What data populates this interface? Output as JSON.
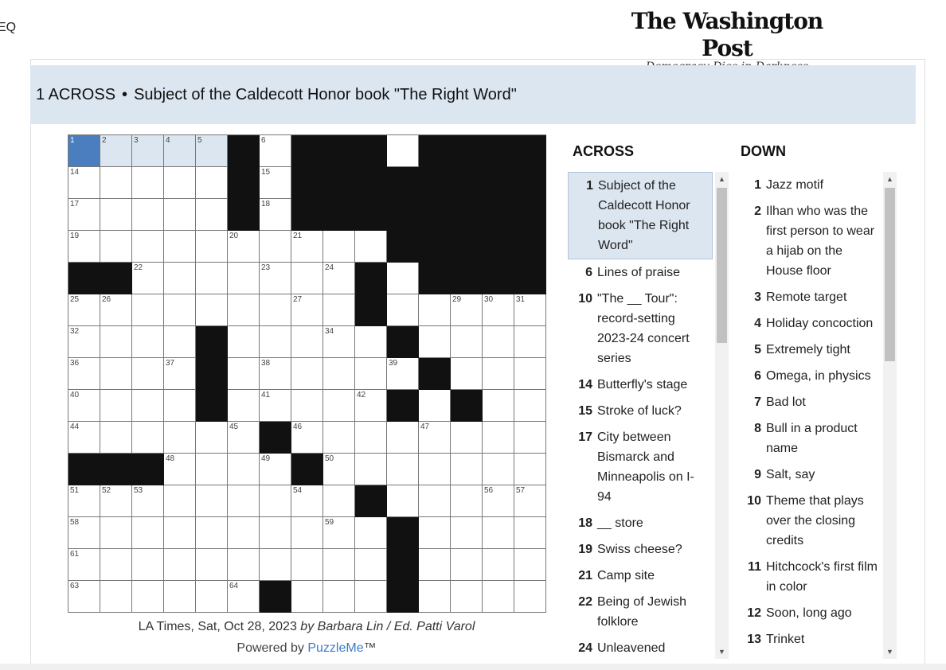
{
  "header": {
    "menu_fragment": "EQ",
    "logo_name": "The Washington Post",
    "logo_tagline": "Democracy Dies in Darkness"
  },
  "banner": {
    "clue_ref": "1 ACROSS",
    "separator": "•",
    "clue_text": "Subject of the Caldecott Honor book \"The Right Word\""
  },
  "grid": {
    "size": 15,
    "rows": [
      "#####.#...#....",
      "#####.#........",
      "#####.#........",
      "##########.....",
      "..#######.#....",
      "#########.#####",
      "####.#####.####",
      "####.######.###",
      "####.#####.#.##",
      "######.########",
      "...####.#######",
      "#########.#####",
      "##########.####",
      "##########.####",
      "######.###.####"
    ],
    "numbers": [
      [
        0,
        0,
        1
      ],
      [
        0,
        1,
        2
      ],
      [
        0,
        2,
        3
      ],
      [
        0,
        3,
        4
      ],
      [
        0,
        4,
        5
      ],
      [
        0,
        6,
        6
      ],
      [
        0,
        7,
        7
      ],
      [
        0,
        8,
        8
      ],
      [
        0,
        9,
        9
      ],
      [
        0,
        11,
        10
      ],
      [
        0,
        12,
        11
      ],
      [
        0,
        13,
        12
      ],
      [
        0,
        14,
        13
      ],
      [
        1,
        0,
        14
      ],
      [
        1,
        6,
        15
      ],
      [
        1,
        10,
        16
      ],
      [
        2,
        0,
        17
      ],
      [
        2,
        6,
        18
      ],
      [
        3,
        0,
        19
      ],
      [
        3,
        5,
        20
      ],
      [
        3,
        7,
        21
      ],
      [
        4,
        2,
        22
      ],
      [
        4,
        6,
        23
      ],
      [
        4,
        8,
        24
      ],
      [
        5,
        0,
        25
      ],
      [
        5,
        1,
        26
      ],
      [
        5,
        7,
        27
      ],
      [
        5,
        9,
        28
      ],
      [
        5,
        12,
        29
      ],
      [
        5,
        13,
        30
      ],
      [
        5,
        14,
        31
      ],
      [
        6,
        0,
        32
      ],
      [
        6,
        4,
        33
      ],
      [
        6,
        8,
        34
      ],
      [
        6,
        10,
        35
      ],
      [
        7,
        0,
        36
      ],
      [
        7,
        3,
        37
      ],
      [
        7,
        6,
        38
      ],
      [
        7,
        10,
        39
      ],
      [
        8,
        0,
        40
      ],
      [
        8,
        6,
        41
      ],
      [
        8,
        9,
        42
      ],
      [
        8,
        12,
        43
      ],
      [
        9,
        0,
        44
      ],
      [
        9,
        5,
        45
      ],
      [
        9,
        7,
        46
      ],
      [
        9,
        11,
        47
      ],
      [
        10,
        3,
        48
      ],
      [
        10,
        6,
        49
      ],
      [
        10,
        8,
        50
      ],
      [
        11,
        0,
        51
      ],
      [
        11,
        1,
        52
      ],
      [
        11,
        2,
        53
      ],
      [
        11,
        7,
        54
      ],
      [
        11,
        9,
        55
      ],
      [
        11,
        13,
        56
      ],
      [
        11,
        14,
        57
      ],
      [
        12,
        0,
        58
      ],
      [
        12,
        8,
        59
      ],
      [
        12,
        10,
        60
      ],
      [
        13,
        0,
        61
      ],
      [
        13,
        10,
        62
      ],
      [
        14,
        0,
        63
      ],
      [
        14,
        5,
        64
      ],
      [
        14,
        10,
        65
      ]
    ]
  },
  "credit": {
    "pub": "LA Times, Sat, Oct 28, 2023",
    "by": "by Barbara Lin / Ed. Patti Varol"
  },
  "powered": {
    "prefix": "Powered by",
    "link": "PuzzleMe",
    "suffix": "™"
  },
  "across": {
    "heading": "ACROSS",
    "clues": [
      {
        "n": "1",
        "t": "Subject of the Caldecott Honor book \"The Right Word\""
      },
      {
        "n": "6",
        "t": "Lines of praise"
      },
      {
        "n": "10",
        "t": "\"The __ Tour\": record-setting 2023-24 concert series"
      },
      {
        "n": "14",
        "t": "Butterfly's stage"
      },
      {
        "n": "15",
        "t": "Stroke of luck?"
      },
      {
        "n": "17",
        "t": "City between Bismarck and Minneapolis on I-94"
      },
      {
        "n": "18",
        "t": "__ store"
      },
      {
        "n": "19",
        "t": "Swiss cheese?"
      },
      {
        "n": "21",
        "t": "Camp site"
      },
      {
        "n": "22",
        "t": "Being of Jewish folklore"
      },
      {
        "n": "24",
        "t": "Unleavened"
      }
    ]
  },
  "down": {
    "heading": "DOWN",
    "clues": [
      {
        "n": "1",
        "t": "Jazz motif"
      },
      {
        "n": "2",
        "t": "Ilhan who was the first person to wear a hijab on the House floor"
      },
      {
        "n": "3",
        "t": "Remote target"
      },
      {
        "n": "4",
        "t": "Holiday concoction"
      },
      {
        "n": "5",
        "t": "Extremely tight"
      },
      {
        "n": "6",
        "t": "Omega, in physics"
      },
      {
        "n": "7",
        "t": "Bad lot"
      },
      {
        "n": "8",
        "t": "Bull in a product name"
      },
      {
        "n": "9",
        "t": "Salt, say"
      },
      {
        "n": "10",
        "t": "Theme that plays over the closing credits"
      },
      {
        "n": "11",
        "t": "Hitchcock's first film in color"
      },
      {
        "n": "12",
        "t": "Soon, long ago"
      },
      {
        "n": "13",
        "t": "Trinket"
      }
    ]
  }
}
